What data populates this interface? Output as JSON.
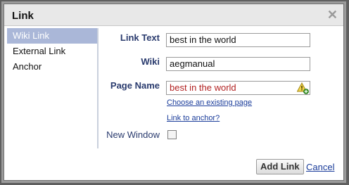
{
  "dialog": {
    "title": "Link",
    "close_icon": "close-icon"
  },
  "sidebar": {
    "items": [
      {
        "label": "Wiki Link",
        "selected": true
      },
      {
        "label": "External Link",
        "selected": false
      },
      {
        "label": "Anchor",
        "selected": false
      }
    ]
  },
  "form": {
    "link_text_label": "Link Text",
    "link_text_value": "best in the world",
    "wiki_label": "Wiki",
    "wiki_value": "aegmanual",
    "page_name_label": "Page Name",
    "page_name_value": "best in the world",
    "page_name_status_icon": "warning-add-icon",
    "choose_existing_link": "Choose an existing page",
    "link_to_anchor_link": "Link to anchor?",
    "new_window_label": "New Window",
    "new_window_checked": false
  },
  "footer": {
    "add_link_label": "Add Link",
    "cancel_label": "Cancel"
  },
  "colors": {
    "selected_bg": "#aab7d8",
    "label_color": "#2a3b6e",
    "link_color": "#1a3c9a",
    "warning_text": "#b22222"
  }
}
